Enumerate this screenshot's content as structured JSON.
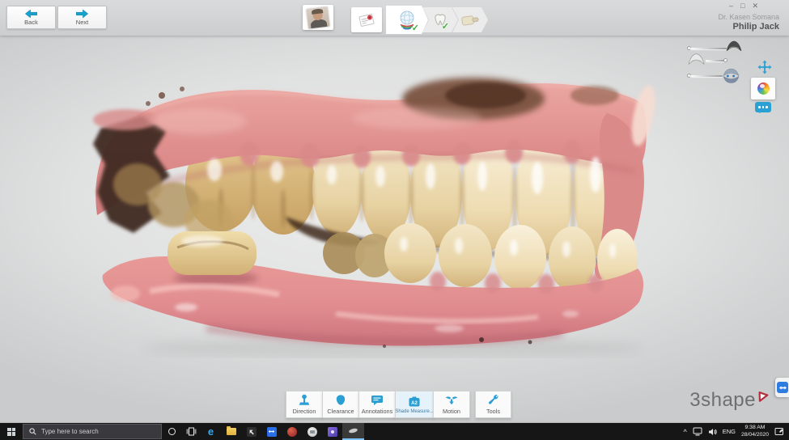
{
  "window": {
    "minimize": "–",
    "maximize": "□",
    "close": "✕"
  },
  "header": {
    "back": "Back",
    "next": "Next",
    "doctor": "Dr. Kasen Somana",
    "patient": "Philip Jack"
  },
  "workflow": {
    "steps": [
      "order-form",
      "scan",
      "design",
      "manufacture"
    ],
    "check": "✓"
  },
  "side_panel": {
    "scans": [
      "upper-jaw-scan",
      "lower-jaw-scan",
      "bite-scan"
    ]
  },
  "toolbar": {
    "buttons": [
      {
        "label": "Direction"
      },
      {
        "label": "Clearance"
      },
      {
        "label": "Annotations"
      },
      {
        "label": "Shade Measure...",
        "shade_value": "A2"
      },
      {
        "label": "Motion"
      },
      {
        "label": "Tools"
      }
    ]
  },
  "branding": {
    "logo": "3shape"
  },
  "taskbar": {
    "search_placeholder": "Type here to search",
    "edge_glyph": "e",
    "tray": {
      "chevron": "^",
      "language": "ENG",
      "time": "9:38 AM",
      "date": "28/04/2020"
    }
  }
}
